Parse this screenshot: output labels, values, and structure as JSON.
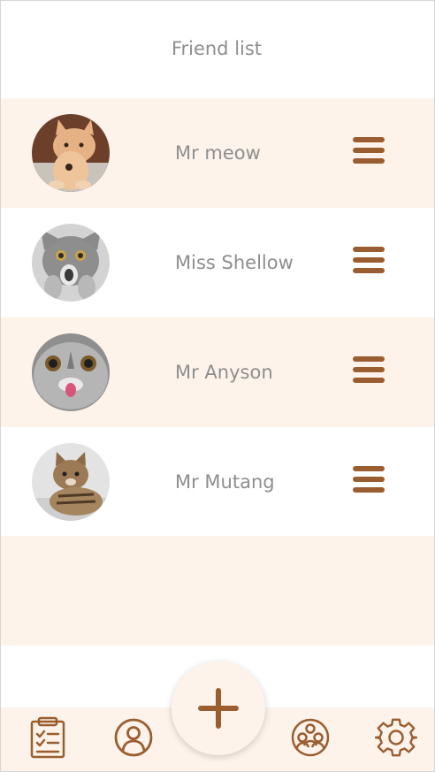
{
  "header": {
    "title": "Friend list"
  },
  "friends": [
    {
      "name": "Mr meow"
    },
    {
      "name": "Miss Shellow"
    },
    {
      "name": "Mr Anyson"
    },
    {
      "name": "Mr Mutang"
    }
  ],
  "tabbar": {
    "items": [
      {
        "icon": "clipboard-icon"
      },
      {
        "icon": "profile-icon"
      },
      {
        "icon": "add-icon"
      },
      {
        "icon": "group-icon"
      },
      {
        "icon": "gear-icon"
      }
    ]
  },
  "colors": {
    "accent": "#9a5d2f",
    "tint": "#fdf3ea",
    "text": "#8e8e8e"
  }
}
